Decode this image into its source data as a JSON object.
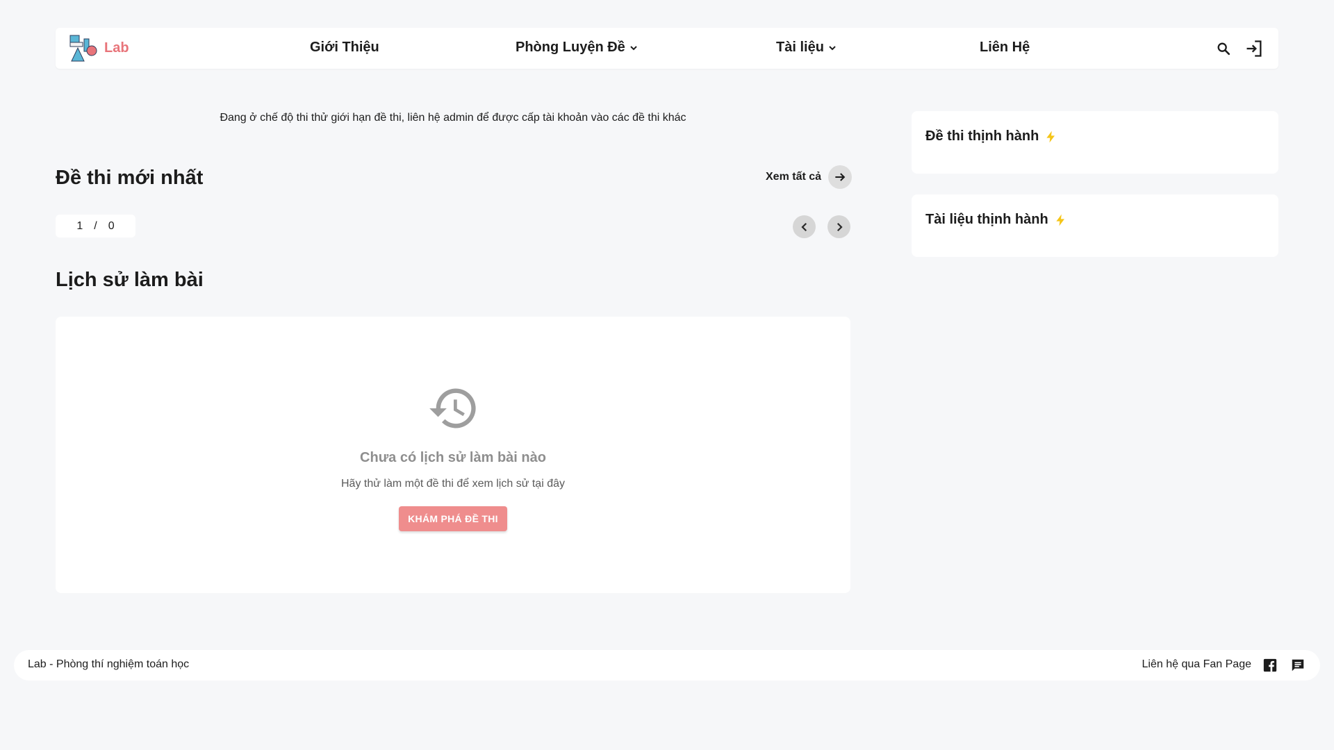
{
  "header": {
    "logo_text": "Lab",
    "nav": {
      "intro": "Giới Thiệu",
      "practice": "Phòng Luyện Đề",
      "documents": "Tài liệu",
      "contact": "Liên Hệ"
    }
  },
  "notice": "Đang ở chế độ thi thử giới hạn đề thi, liên hệ admin để được cấp tài khoản vào các đề thi khác",
  "latest": {
    "title": "Đề thi mới nhất",
    "view_all": "Xem tất cả",
    "pager": {
      "current": "1",
      "separator": "/",
      "total": "0"
    }
  },
  "history": {
    "title": "Lịch sử làm bài",
    "empty_title": "Chưa có lịch sử làm bài nào",
    "empty_subtitle": "Hãy thử làm một đề thi để xem lịch sử tại đây",
    "explore_button": "KHÁM PHÁ ĐỀ THI"
  },
  "sidebar": {
    "trending_exams": "Đề thi thịnh hành",
    "trending_docs": "Tài liệu thịnh hành"
  },
  "footer": {
    "left_text": "Lab - Phòng thí nghiệm toán học",
    "right_text": "Liên hệ qua Fan Page"
  },
  "colors": {
    "brand": "#e8747a",
    "button": "#ef8d8d",
    "background": "#f6f7f9",
    "lightning": "#f5c518"
  },
  "icons": {
    "search": "search-icon",
    "login": "login-icon",
    "history": "history-icon",
    "facebook": "facebook-icon",
    "chat": "chat-icon"
  }
}
